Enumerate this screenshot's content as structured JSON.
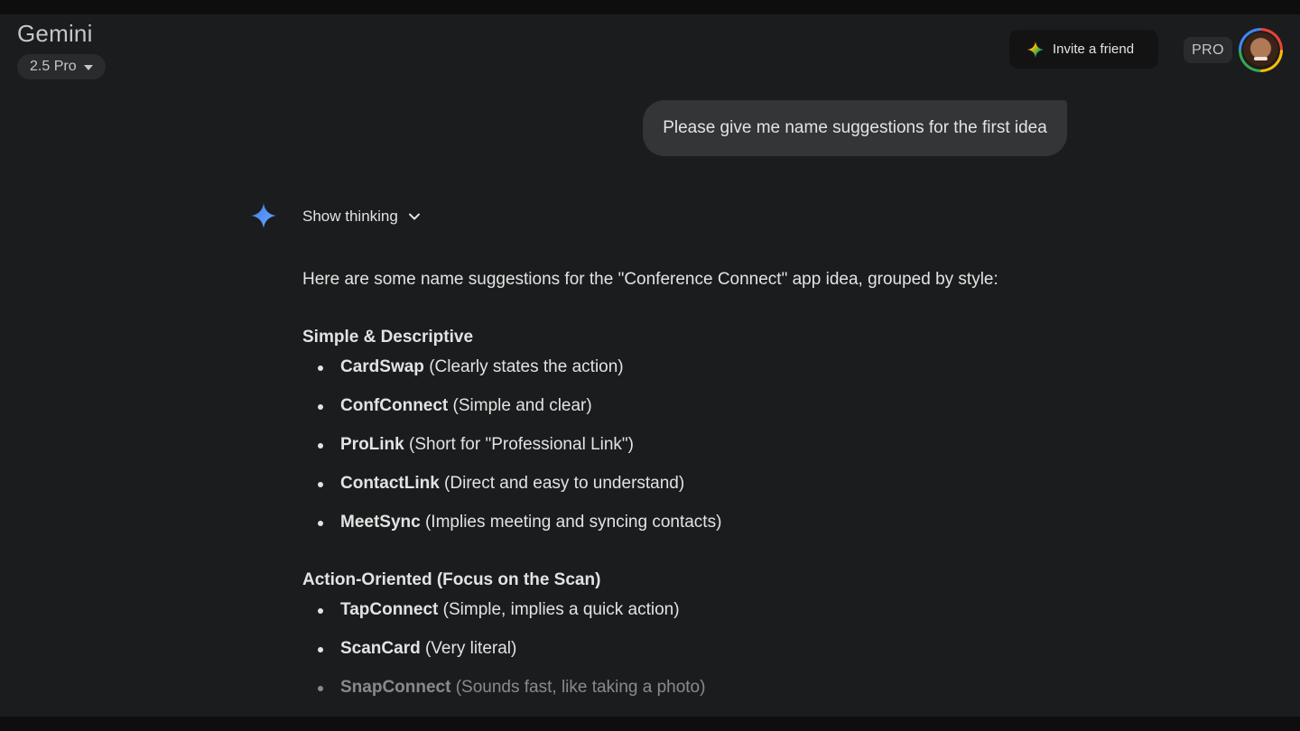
{
  "header": {
    "app_title": "Gemini",
    "model_label": "2.5 Pro",
    "invite_label": "Invite a friend",
    "pro_badge": "PRO"
  },
  "conversation": {
    "user_message": "Please give me name suggestions for the first idea",
    "show_thinking_label": "Show thinking",
    "intro": "Here are some name suggestions for the \"Conference Connect\" app idea, grouped by style:",
    "sections": [
      {
        "heading": "Simple & Descriptive",
        "items": [
          {
            "name": "CardSwap",
            "note": " (Clearly states the action)"
          },
          {
            "name": "ConfConnect",
            "note": " (Simple and clear)"
          },
          {
            "name": "ProLink",
            "note": " (Short for \"Professional Link\")"
          },
          {
            "name": "ContactLink",
            "note": " (Direct and easy to understand)"
          },
          {
            "name": "MeetSync",
            "note": " (Implies meeting and syncing contacts)"
          }
        ]
      },
      {
        "heading": "Action-Oriented (Focus on the Scan)",
        "items": [
          {
            "name": "TapConnect",
            "note": " (Simple, implies a quick action)"
          },
          {
            "name": "ScanCard",
            "note": " (Very literal)"
          },
          {
            "name": "SnapConnect",
            "note": " (Sounds fast, like taking a photo)"
          }
        ]
      }
    ]
  },
  "icons": {
    "sparkle": "gemini-sparkle-icon",
    "caret": "caret-down-icon",
    "chevron": "chevron-down-icon",
    "avatar": "user-avatar"
  },
  "colors": {
    "background": "#1b1c1d",
    "bubble": "#333537",
    "text": "#e3e3e3",
    "sparkle_blue": "#4b8df8"
  }
}
